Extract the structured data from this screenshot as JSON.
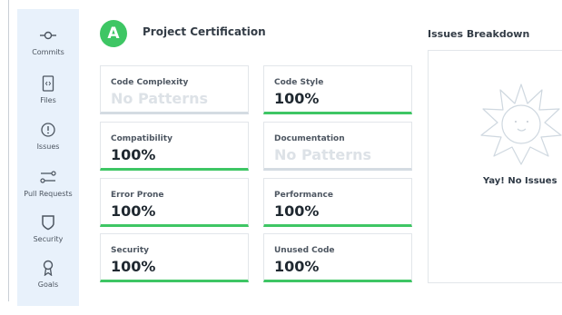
{
  "sidebar": {
    "items": [
      {
        "label": "Commits",
        "icon": "commit-icon"
      },
      {
        "label": "Files",
        "icon": "file-icon"
      },
      {
        "label": "Issues",
        "icon": "alert-circle-icon"
      },
      {
        "label": "Pull Requests",
        "icon": "pull-request-icon"
      },
      {
        "label": "Security",
        "icon": "shield-icon"
      },
      {
        "label": "Goals",
        "icon": "award-icon"
      }
    ]
  },
  "header": {
    "grade": "A",
    "title": "Project Certification"
  },
  "categories": [
    {
      "title": "Code Complexity",
      "value": "No Patterns"
    },
    {
      "title": "Code Style",
      "value": "100%"
    },
    {
      "title": "Compatibility",
      "value": "100%"
    },
    {
      "title": "Documentation",
      "value": "No Patterns"
    },
    {
      "title": "Error Prone",
      "value": "100%"
    },
    {
      "title": "Performance",
      "value": "100%"
    },
    {
      "title": "Security",
      "value": "100%"
    },
    {
      "title": "Unused Code",
      "value": "100%"
    }
  ],
  "issues": {
    "title": "Issues Breakdown",
    "empty_message": "Yay! No Issues",
    "illustration": "sun-icon"
  },
  "colors": {
    "accent": "#3ec664",
    "sidebar_bg": "#e8f1fb",
    "muted_bar": "#d4dbe2"
  }
}
